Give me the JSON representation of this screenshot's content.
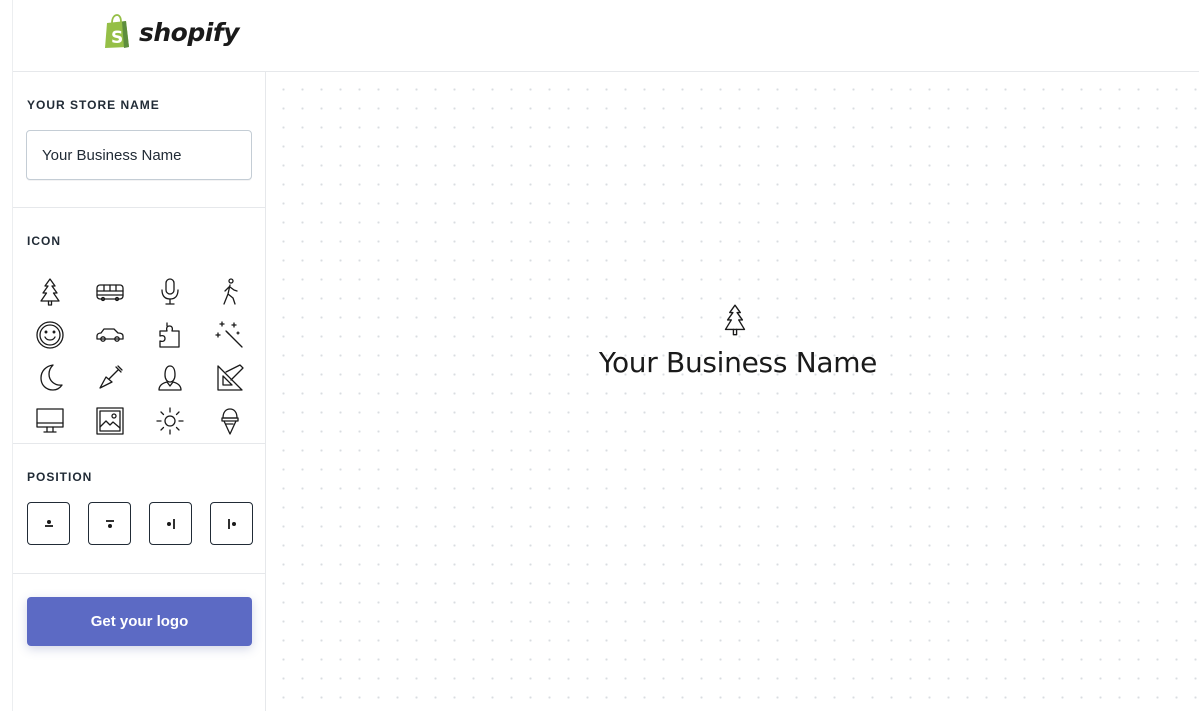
{
  "brand": {
    "name": "shopify",
    "accent": "#5c6ac4",
    "logo_green": "#95bf47"
  },
  "sidebar": {
    "store_section": {
      "label": "YOUR STORE NAME",
      "input_value": "Your Business Name"
    },
    "icon_section": {
      "label": "ICON",
      "icons": [
        "tree-icon",
        "bus-icon",
        "microphone-icon",
        "walking-person-icon",
        "smiley-icon",
        "car-icon",
        "puzzle-icon",
        "magic-wand-icon",
        "moon-icon",
        "shovel-icon",
        "person-icon",
        "ruler-triangle-icon",
        "monitor-icon",
        "picture-icon",
        "sun-icon",
        "ice-cream-icon"
      ],
      "selected": "tree-icon"
    },
    "position_section": {
      "label": "POSITION",
      "options": [
        "icon-above",
        "icon-top",
        "icon-left",
        "icon-right"
      ]
    },
    "cta": {
      "label": "Get your logo"
    }
  },
  "preview": {
    "name": "Your Business Name",
    "icon": "tree-icon"
  }
}
